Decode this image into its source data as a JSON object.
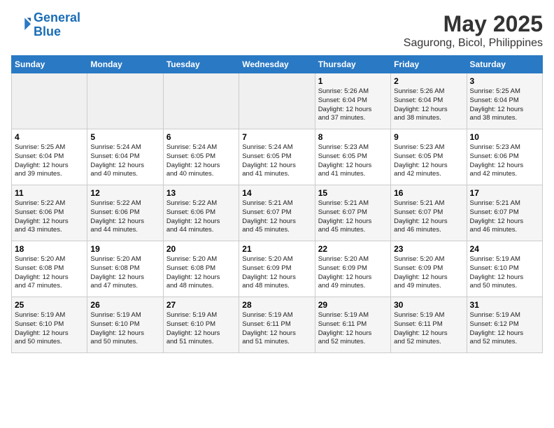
{
  "logo": {
    "line1": "General",
    "line2": "Blue"
  },
  "title": "May 2025",
  "subtitle": "Sagurong, Bicol, Philippines",
  "headers": [
    "Sunday",
    "Monday",
    "Tuesday",
    "Wednesday",
    "Thursday",
    "Friday",
    "Saturday"
  ],
  "weeks": [
    [
      {
        "num": "",
        "info": ""
      },
      {
        "num": "",
        "info": ""
      },
      {
        "num": "",
        "info": ""
      },
      {
        "num": "",
        "info": ""
      },
      {
        "num": "1",
        "info": "Sunrise: 5:26 AM\nSunset: 6:04 PM\nDaylight: 12 hours\nand 37 minutes."
      },
      {
        "num": "2",
        "info": "Sunrise: 5:26 AM\nSunset: 6:04 PM\nDaylight: 12 hours\nand 38 minutes."
      },
      {
        "num": "3",
        "info": "Sunrise: 5:25 AM\nSunset: 6:04 PM\nDaylight: 12 hours\nand 38 minutes."
      }
    ],
    [
      {
        "num": "4",
        "info": "Sunrise: 5:25 AM\nSunset: 6:04 PM\nDaylight: 12 hours\nand 39 minutes."
      },
      {
        "num": "5",
        "info": "Sunrise: 5:24 AM\nSunset: 6:04 PM\nDaylight: 12 hours\nand 40 minutes."
      },
      {
        "num": "6",
        "info": "Sunrise: 5:24 AM\nSunset: 6:05 PM\nDaylight: 12 hours\nand 40 minutes."
      },
      {
        "num": "7",
        "info": "Sunrise: 5:24 AM\nSunset: 6:05 PM\nDaylight: 12 hours\nand 41 minutes."
      },
      {
        "num": "8",
        "info": "Sunrise: 5:23 AM\nSunset: 6:05 PM\nDaylight: 12 hours\nand 41 minutes."
      },
      {
        "num": "9",
        "info": "Sunrise: 5:23 AM\nSunset: 6:05 PM\nDaylight: 12 hours\nand 42 minutes."
      },
      {
        "num": "10",
        "info": "Sunrise: 5:23 AM\nSunset: 6:06 PM\nDaylight: 12 hours\nand 42 minutes."
      }
    ],
    [
      {
        "num": "11",
        "info": "Sunrise: 5:22 AM\nSunset: 6:06 PM\nDaylight: 12 hours\nand 43 minutes."
      },
      {
        "num": "12",
        "info": "Sunrise: 5:22 AM\nSunset: 6:06 PM\nDaylight: 12 hours\nand 44 minutes."
      },
      {
        "num": "13",
        "info": "Sunrise: 5:22 AM\nSunset: 6:06 PM\nDaylight: 12 hours\nand 44 minutes."
      },
      {
        "num": "14",
        "info": "Sunrise: 5:21 AM\nSunset: 6:07 PM\nDaylight: 12 hours\nand 45 minutes."
      },
      {
        "num": "15",
        "info": "Sunrise: 5:21 AM\nSunset: 6:07 PM\nDaylight: 12 hours\nand 45 minutes."
      },
      {
        "num": "16",
        "info": "Sunrise: 5:21 AM\nSunset: 6:07 PM\nDaylight: 12 hours\nand 46 minutes."
      },
      {
        "num": "17",
        "info": "Sunrise: 5:21 AM\nSunset: 6:07 PM\nDaylight: 12 hours\nand 46 minutes."
      }
    ],
    [
      {
        "num": "18",
        "info": "Sunrise: 5:20 AM\nSunset: 6:08 PM\nDaylight: 12 hours\nand 47 minutes."
      },
      {
        "num": "19",
        "info": "Sunrise: 5:20 AM\nSunset: 6:08 PM\nDaylight: 12 hours\nand 47 minutes."
      },
      {
        "num": "20",
        "info": "Sunrise: 5:20 AM\nSunset: 6:08 PM\nDaylight: 12 hours\nand 48 minutes."
      },
      {
        "num": "21",
        "info": "Sunrise: 5:20 AM\nSunset: 6:09 PM\nDaylight: 12 hours\nand 48 minutes."
      },
      {
        "num": "22",
        "info": "Sunrise: 5:20 AM\nSunset: 6:09 PM\nDaylight: 12 hours\nand 49 minutes."
      },
      {
        "num": "23",
        "info": "Sunrise: 5:20 AM\nSunset: 6:09 PM\nDaylight: 12 hours\nand 49 minutes."
      },
      {
        "num": "24",
        "info": "Sunrise: 5:19 AM\nSunset: 6:10 PM\nDaylight: 12 hours\nand 50 minutes."
      }
    ],
    [
      {
        "num": "25",
        "info": "Sunrise: 5:19 AM\nSunset: 6:10 PM\nDaylight: 12 hours\nand 50 minutes."
      },
      {
        "num": "26",
        "info": "Sunrise: 5:19 AM\nSunset: 6:10 PM\nDaylight: 12 hours\nand 50 minutes."
      },
      {
        "num": "27",
        "info": "Sunrise: 5:19 AM\nSunset: 6:10 PM\nDaylight: 12 hours\nand 51 minutes."
      },
      {
        "num": "28",
        "info": "Sunrise: 5:19 AM\nSunset: 6:11 PM\nDaylight: 12 hours\nand 51 minutes."
      },
      {
        "num": "29",
        "info": "Sunrise: 5:19 AM\nSunset: 6:11 PM\nDaylight: 12 hours\nand 52 minutes."
      },
      {
        "num": "30",
        "info": "Sunrise: 5:19 AM\nSunset: 6:11 PM\nDaylight: 12 hours\nand 52 minutes."
      },
      {
        "num": "31",
        "info": "Sunrise: 5:19 AM\nSunset: 6:12 PM\nDaylight: 12 hours\nand 52 minutes."
      }
    ]
  ]
}
